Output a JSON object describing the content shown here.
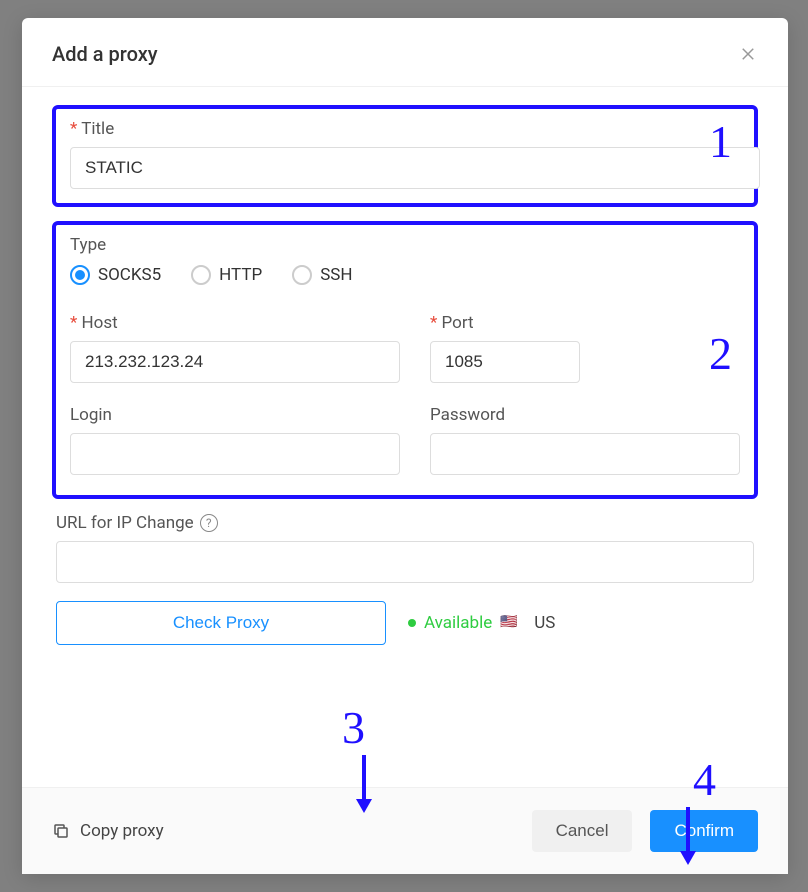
{
  "modal": {
    "title": "Add a proxy"
  },
  "title_field": {
    "label": "Title",
    "value": "STATIC"
  },
  "type": {
    "label": "Type",
    "options": [
      {
        "label": "SOCKS5",
        "selected": true
      },
      {
        "label": "HTTP",
        "selected": false
      },
      {
        "label": "SSH",
        "selected": false
      }
    ]
  },
  "host": {
    "label": "Host",
    "value": "213.232.123.24"
  },
  "port": {
    "label": "Port",
    "value": "1085"
  },
  "login": {
    "label": "Login",
    "value": ""
  },
  "password": {
    "label": "Password",
    "value": ""
  },
  "url_change": {
    "label": "URL for IP Change",
    "value": ""
  },
  "check_button": "Check Proxy",
  "status": {
    "text": "Available",
    "country_code": "US",
    "flag_emoji": "🇺🇸"
  },
  "footer": {
    "copy": "Copy proxy",
    "cancel": "Cancel",
    "confirm": "Confirm"
  },
  "annotations": {
    "n1": "1",
    "n2": "2",
    "n3": "3",
    "n4": "4"
  }
}
